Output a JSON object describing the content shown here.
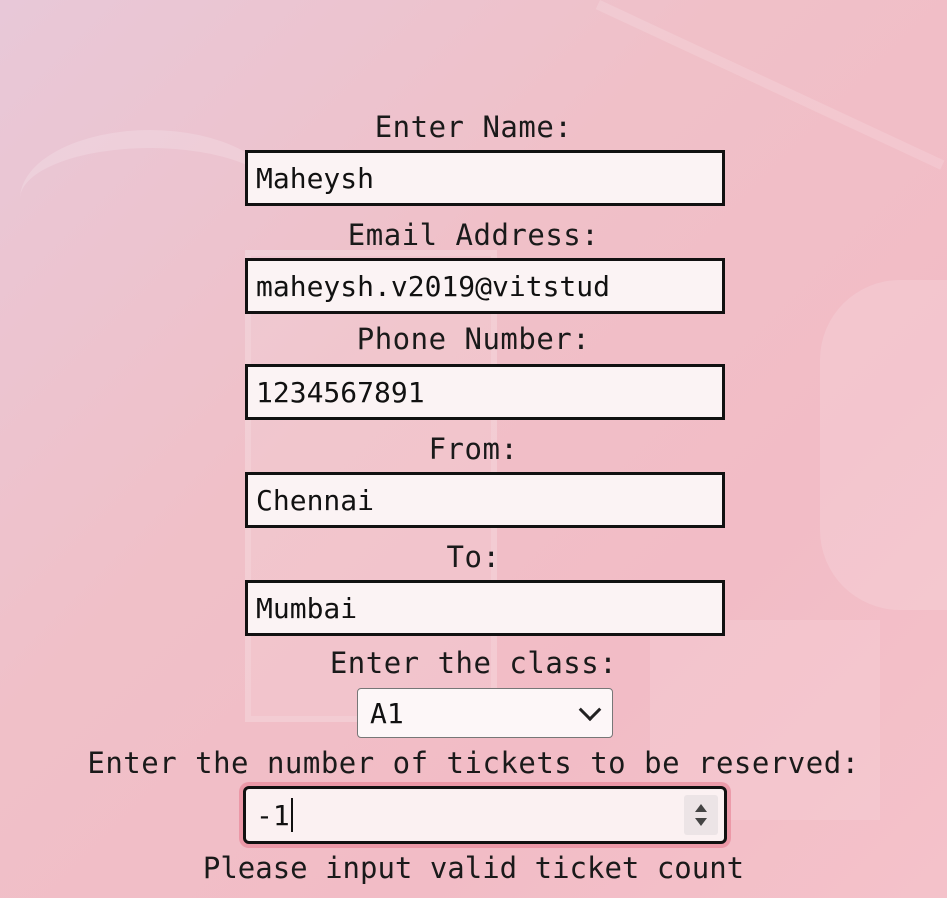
{
  "form": {
    "name_label": "Enter Name:",
    "name_value": "Maheysh",
    "email_label": "Email Address:",
    "email_value": "maheysh.v2019@vitstud",
    "phone_label": "Phone Number:",
    "phone_value": "1234567891",
    "from_label": "From:",
    "from_value": "Chennai",
    "to_label": "To:",
    "to_value": "Mumbai",
    "class_label": "Enter the class:",
    "class_selected": "A1",
    "tickets_label": "Enter the number of tickets to be reserved:",
    "tickets_value": "-1",
    "error_message": "Please input valid ticket count"
  },
  "colors": {
    "background": "#f0c0c8",
    "focus_ring": "#e6788c",
    "field_border": "#111111"
  },
  "icons": {
    "select_arrow": "chevron-down-icon",
    "number_spinner": "spinner-icon"
  }
}
